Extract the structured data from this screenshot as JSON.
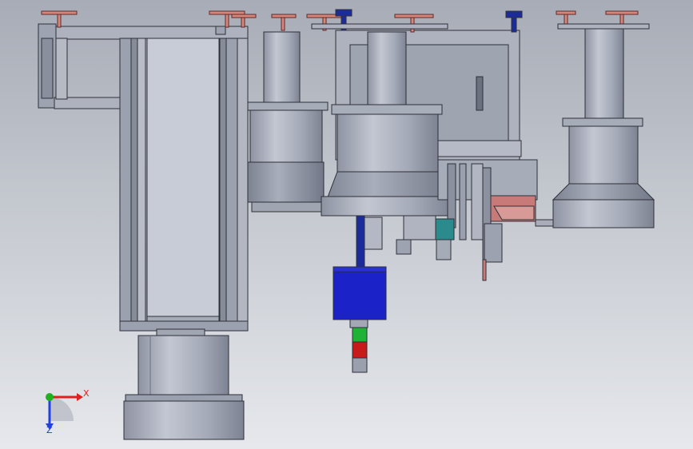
{
  "viewport": {
    "view": "front",
    "background_gradient": [
      "#a7acb6",
      "#c4c8cf",
      "#e6e8ec"
    ]
  },
  "colors": {
    "steel_light": "#b8bcc8",
    "steel_mid": "#9da2b0",
    "steel_dark": "#7b8090",
    "edge": "#2e3038",
    "motor_blue": "#1b22c8",
    "shaft_blue": "#1c2b9a",
    "knob_red": "#d8867a",
    "stack_green": "#1fb335",
    "stack_red": "#c81a1a",
    "axis_x": "#e02020",
    "axis_y": "#20b020",
    "axis_z": "#2040e0"
  },
  "triad": {
    "x_label": "X",
    "z_label": "Z",
    "icon": "coordinate-triad-icon"
  }
}
